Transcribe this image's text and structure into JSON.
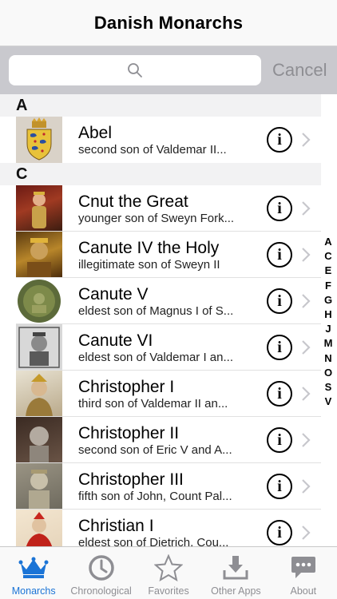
{
  "header": {
    "title": "Danish Monarchs"
  },
  "search": {
    "placeholder": "",
    "cancel_label": "Cancel"
  },
  "sections": [
    {
      "letter": "A",
      "rows": [
        {
          "name": "Abel",
          "subtitle": "second son of Valdemar II...",
          "thumb": "coat-of-arms"
        }
      ]
    },
    {
      "letter": "C",
      "rows": [
        {
          "name": "Cnut the Great",
          "subtitle": "younger son of Sweyn Fork...",
          "thumb": "portrait"
        },
        {
          "name": "Canute IV the Holy",
          "subtitle": "illegitimate son of Sweyn II",
          "thumb": "portrait"
        },
        {
          "name": "Canute V",
          "subtitle": "eldest son of Magnus I of S...",
          "thumb": "coin"
        },
        {
          "name": "Canute VI",
          "subtitle": "eldest son of Valdemar I an...",
          "thumb": "engraving"
        },
        {
          "name": "Christopher I",
          "subtitle": "third son of Valdemar II an...",
          "thumb": "portrait"
        },
        {
          "name": "Christopher II",
          "subtitle": "second son of Eric V and A...",
          "thumb": "sculpture"
        },
        {
          "name": "Christopher III",
          "subtitle": "fifth son of John, Count Pal...",
          "thumb": "sculpture"
        },
        {
          "name": "Christian I",
          "subtitle": "eldest son of Dietrich, Cou...",
          "thumb": "portrait"
        }
      ]
    }
  ],
  "index_letters": [
    "A",
    "C",
    "E",
    "F",
    "G",
    "H",
    "J",
    "M",
    "N",
    "O",
    "S",
    "V"
  ],
  "tabs": [
    {
      "label": "Monarchs",
      "icon": "crown-icon",
      "active": true
    },
    {
      "label": "Chronological",
      "icon": "clock-icon",
      "active": false
    },
    {
      "label": "Favorites",
      "icon": "star-icon",
      "active": false
    },
    {
      "label": "Other Apps",
      "icon": "download-icon",
      "active": false
    },
    {
      "label": "About",
      "icon": "speech-bubble-icon",
      "active": false
    }
  ],
  "colors": {
    "accent": "#1b74d6",
    "inactive": "#8e8e93",
    "search_bar_bg": "#c9c9ce"
  }
}
